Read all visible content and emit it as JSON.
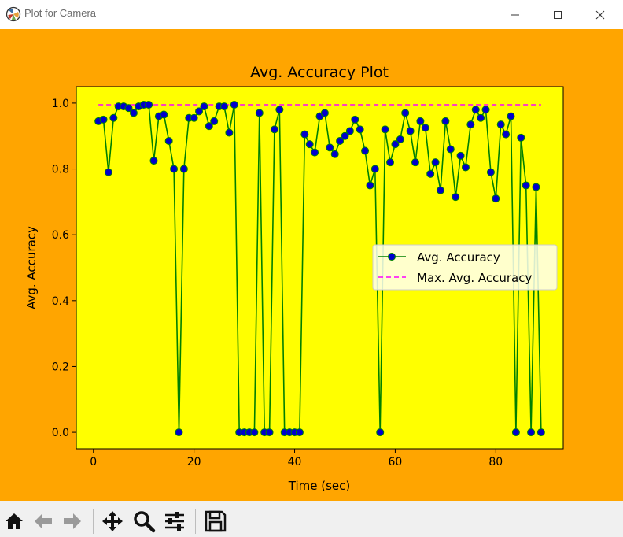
{
  "window": {
    "title": "Plot for Camera"
  },
  "toolbar": {
    "buttons": [
      "home-icon",
      "back-icon",
      "forward-icon",
      "pan-icon",
      "zoom-icon",
      "configure-icon",
      "save-icon"
    ]
  },
  "colors": {
    "figure_bg": "#ffa500",
    "axes_bg": "#ffff00",
    "line": "#008000",
    "marker_face": "#0000cd",
    "max_line": "#ff00ff"
  },
  "chart_data": {
    "type": "line",
    "title": "Avg. Accuracy Plot",
    "xlabel": "Time (sec)",
    "ylabel": "Avg. Accuracy",
    "xlim": [
      -3.4,
      93.4
    ],
    "ylim": [
      -0.05,
      1.05
    ],
    "xticks": [
      0,
      20,
      40,
      60,
      80
    ],
    "yticks": [
      0.0,
      0.2,
      0.4,
      0.6,
      0.8,
      1.0
    ],
    "xtick_labels": [
      "0",
      "20",
      "40",
      "60",
      "80"
    ],
    "ytick_labels": [
      "0.0",
      "0.2",
      "0.4",
      "0.6",
      "0.8",
      "1.0"
    ],
    "legend_position": "center-right",
    "legend": [
      "Avg. Accuracy",
      "Max. Avg. Accuracy"
    ],
    "series": [
      {
        "name": "Avg. Accuracy",
        "style": "solid-with-markers",
        "x": [
          1,
          2,
          3,
          4,
          5,
          6,
          7,
          8,
          9,
          10,
          11,
          12,
          13,
          14,
          15,
          16,
          17,
          18,
          19,
          20,
          21,
          22,
          23,
          24,
          25,
          26,
          27,
          28,
          29,
          30,
          31,
          32,
          33,
          34,
          35,
          36,
          37,
          38,
          39,
          40,
          41,
          42,
          43,
          44,
          45,
          46,
          47,
          48,
          49,
          50,
          51,
          52,
          53,
          54,
          55,
          56,
          57,
          58,
          59,
          60,
          61,
          62,
          63,
          64,
          65,
          66,
          67,
          68,
          69,
          70,
          71,
          72,
          73,
          74,
          75,
          76,
          77,
          78,
          79,
          80,
          81,
          82,
          83,
          84,
          85,
          86,
          87,
          88,
          89
        ],
        "values": [
          0.945,
          0.95,
          0.79,
          0.955,
          0.99,
          0.99,
          0.985,
          0.97,
          0.99,
          0.995,
          0.995,
          0.825,
          0.96,
          0.965,
          0.885,
          0.8,
          0.0,
          0.8,
          0.955,
          0.955,
          0.975,
          0.99,
          0.93,
          0.945,
          0.99,
          0.99,
          0.91,
          0.995,
          0.0,
          0.0,
          0.0,
          0.0,
          0.97,
          0.0,
          0.0,
          0.92,
          0.98,
          0.0,
          0.0,
          0.0,
          0.0,
          0.905,
          0.875,
          0.85,
          0.96,
          0.97,
          0.865,
          0.845,
          0.885,
          0.9,
          0.915,
          0.95,
          0.92,
          0.855,
          0.75,
          0.8,
          0.0,
          0.92,
          0.82,
          0.875,
          0.89,
          0.97,
          0.915,
          0.82,
          0.945,
          0.925,
          0.785,
          0.82,
          0.735,
          0.945,
          0.86,
          0.715,
          0.84,
          0.805,
          0.935,
          0.98,
          0.955,
          0.98,
          0.79,
          0.71,
          0.935,
          0.905,
          0.96,
          0.0,
          0.895,
          0.75,
          0.0,
          0.745,
          0.0
        ]
      },
      {
        "name": "Max. Avg. Accuracy",
        "style": "dashed",
        "x": [
          1,
          89
        ],
        "values": [
          0.995,
          0.995
        ]
      }
    ]
  }
}
